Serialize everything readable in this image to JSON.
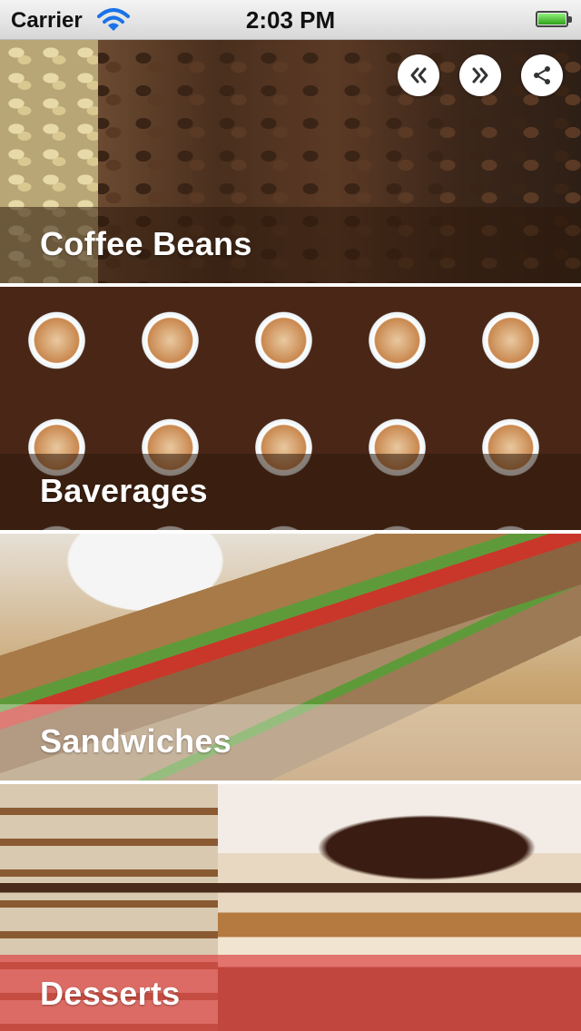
{
  "status_bar": {
    "carrier": "Carrier",
    "time": "2:03 PM"
  },
  "toolbar": {
    "back_icon": "double-chevron-left-icon",
    "forward_icon": "double-chevron-right-icon",
    "share_icon": "share-icon"
  },
  "categories": [
    {
      "label": "Coffee Beans"
    },
    {
      "label": "Baverages"
    },
    {
      "label": "Sandwiches"
    },
    {
      "label": "Desserts"
    }
  ]
}
